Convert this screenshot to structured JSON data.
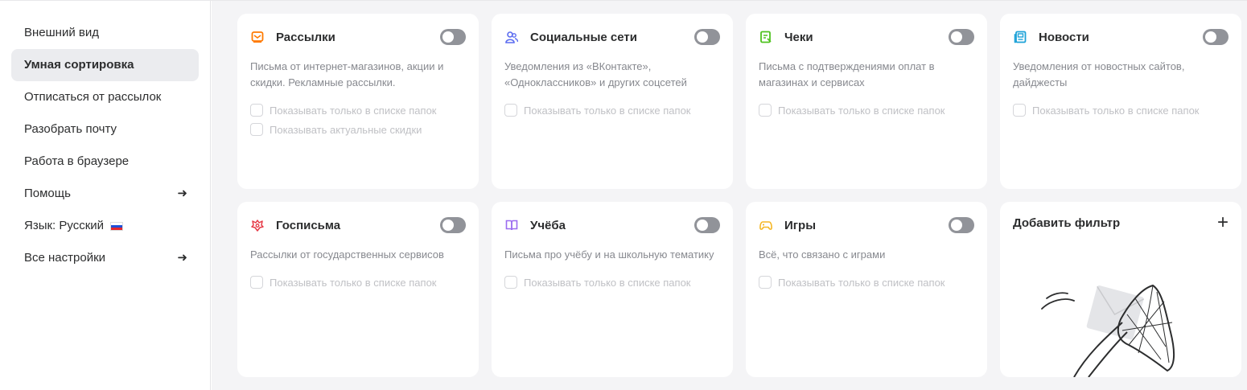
{
  "sidebar": {
    "items": [
      {
        "label": "Внешний вид"
      },
      {
        "label": "Умная сортировка"
      },
      {
        "label": "Отписаться от рассылок"
      },
      {
        "label": "Разобрать почту"
      },
      {
        "label": "Работа в браузере"
      },
      {
        "label": "Помощь",
        "arrow": "➜"
      },
      {
        "label": "Язык: Русский"
      },
      {
        "label": "Все настройки",
        "arrow": "➜"
      }
    ]
  },
  "cards": [
    {
      "title": "Рассылки",
      "icon": "newsletter-icon",
      "color": "#ff7a00",
      "desc": "Письма от интернет-магазинов, акции и скидки. Рекламные рассылки.",
      "opts": [
        "Показывать только в списке папок",
        "Показывать актуальные скидки"
      ],
      "enabled": false
    },
    {
      "title": "Социальные сети",
      "icon": "people-icon",
      "color": "#5b6cf0",
      "desc": "Уведомления из «ВКонтакте», «Одноклассников» и других соцсетей",
      "opts": [
        "Показывать только в списке папок"
      ],
      "enabled": false
    },
    {
      "title": "Чеки",
      "icon": "receipt-icon",
      "color": "#4fc21f",
      "desc": "Письма с подтверждениями оплат в магазинах и сервисах",
      "opts": [
        "Показывать только в списке папок"
      ],
      "enabled": false
    },
    {
      "title": "Новости",
      "icon": "news-icon",
      "color": "#1da2d8",
      "desc": "Уведомления от новостных сайтов, дайджесты",
      "opts": [
        "Показывать только в списке папок"
      ],
      "enabled": false
    },
    {
      "title": "Госписьма",
      "icon": "emblem-icon",
      "color": "#e63946",
      "desc": "Рассылки от государственных сервисов",
      "opts": [
        "Показывать только в списке папок"
      ],
      "enabled": false
    },
    {
      "title": "Учёба",
      "icon": "book-icon",
      "color": "#9b6cf0",
      "desc": "Письма про учёбу и на школьную тематику",
      "opts": [
        "Показывать только в списке папок"
      ],
      "enabled": false
    },
    {
      "title": "Игры",
      "icon": "gamepad-icon",
      "color": "#f5b623",
      "desc": "Всё, что связано с играми",
      "opts": [
        "Показывать только в списке папок"
      ],
      "enabled": false
    }
  ],
  "add_filter": {
    "title": "Добавить фильтр",
    "plus": "+"
  }
}
